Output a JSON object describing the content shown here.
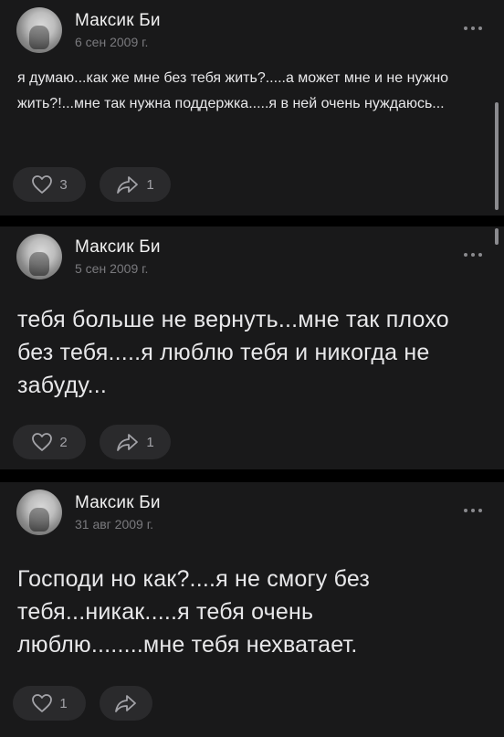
{
  "posts": [
    {
      "author": "Максик Би",
      "date": "6 сен 2009 г.",
      "text": "я думаю...как же мне без тебя жить?.....а может мне и не нужно жить?!...мне так нужна поддержка.....я в ней очень нуждаюсь...",
      "likes": "3",
      "shares": "1"
    },
    {
      "author": "Максик Би",
      "date": "5 сен 2009 г.",
      "text": "тебя больше не вернуть...мне так плохо без тебя.....я люблю тебя и никогда не забуду...",
      "likes": "2",
      "shares": "1"
    },
    {
      "author": "Максик Би",
      "date": "31 авг 2009 г.",
      "text": "Господи но как?....я не смогу без тебя...никак.....я тебя очень люблю........мне тебя нехватает.",
      "likes": "1",
      "shares": ""
    }
  ],
  "icons": {
    "like": "heart-icon",
    "share": "share-arrow-icon",
    "more": "more-dots-icon"
  },
  "colors": {
    "background": "#000000",
    "card": "#19191a",
    "pill": "#2a2a2c",
    "text": "#e1e3e6",
    "muted": "#7a7a7e"
  }
}
